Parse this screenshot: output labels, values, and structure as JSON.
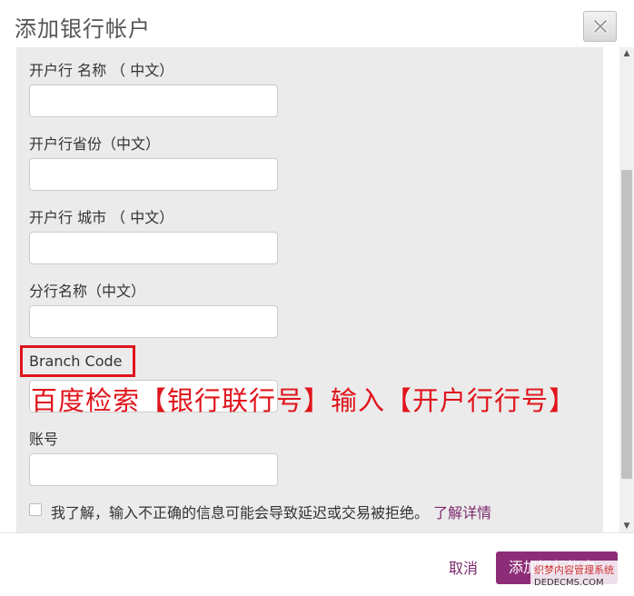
{
  "dialog": {
    "title": "添加银行帐户",
    "close_icon": "close-x-icon"
  },
  "form": {
    "fields": [
      {
        "label": "开户行 名称 （ 中文）",
        "value": ""
      },
      {
        "label": "开户行省份（中文）",
        "value": ""
      },
      {
        "label": "开户行 城市 （ 中文）",
        "value": ""
      },
      {
        "label": "分行名称（中文）",
        "value": ""
      },
      {
        "label": "Branch Code",
        "value": ""
      },
      {
        "label": "账号",
        "value": ""
      }
    ],
    "annotation": "百度检索【银行联行号】输入【开户行行号】",
    "annotation_color": "#e0141b",
    "agree_text": "我了解，输入不正确的信息可能会导致延迟或交易被拒绝。",
    "learn_more": "了解详情"
  },
  "footer": {
    "cancel_label": "取消",
    "submit_label": "添加银行帐户",
    "accent_color": "#8e2d77"
  },
  "watermark": {
    "line1": "织梦内容管理系统",
    "line2": "DEDECMS.COM"
  }
}
